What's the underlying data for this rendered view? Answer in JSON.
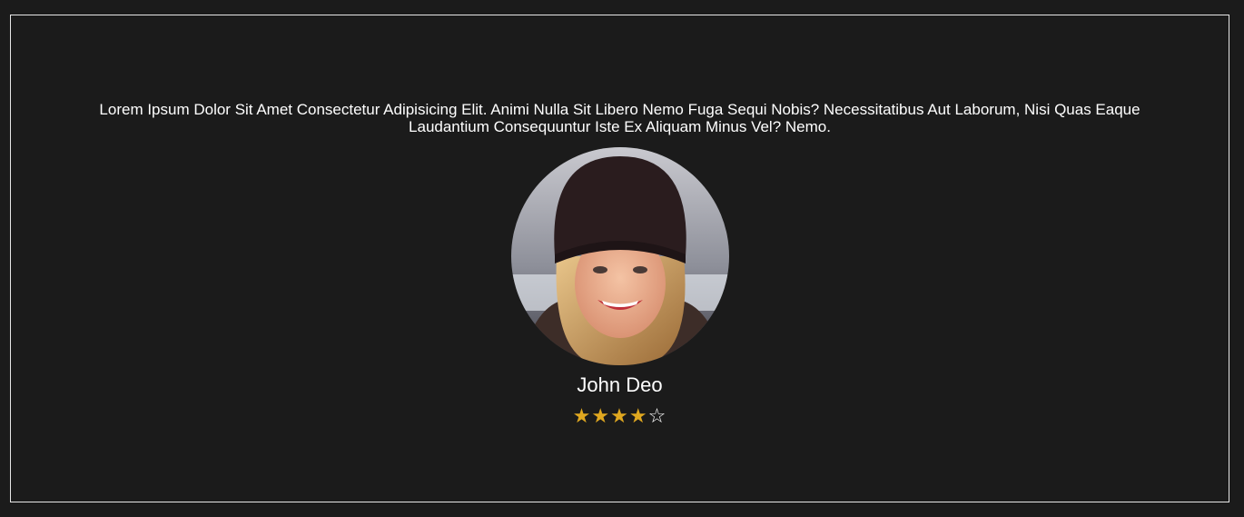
{
  "testimonial": {
    "quote": "Lorem Ipsum Dolor Sit Amet Consectetur Adipisicing Elit. Animi Nulla Sit Libero Nemo Fuga Sequi Nobis? Necessitatibus Aut Laborum, Nisi Quas Eaque Laudantium Consequuntur Iste Ex Aliquam Minus Vel? Nemo.",
    "name": "John Deo",
    "rating": 4,
    "rating_max": 5,
    "avatar_icon": "user-photo"
  },
  "colors": {
    "background": "#1b1b1b",
    "border": "#e6e6e6",
    "text": "#ffffff",
    "star_filled": "#e0a820",
    "star_empty": "#ffffff"
  }
}
